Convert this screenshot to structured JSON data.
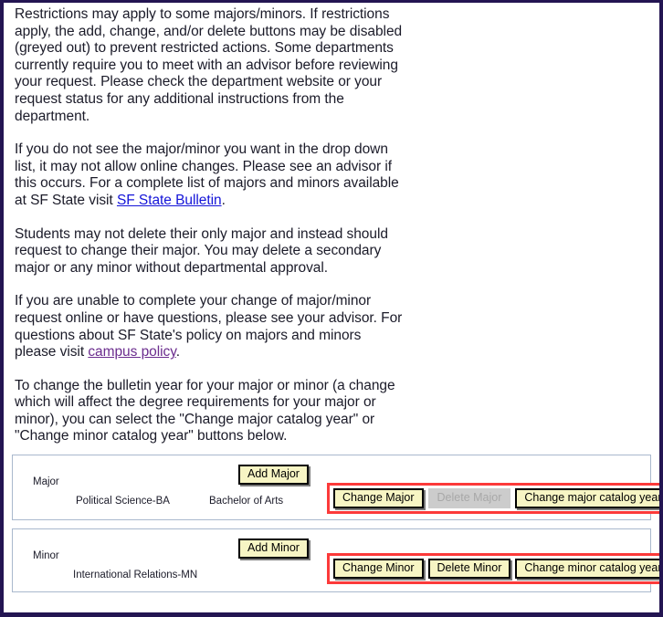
{
  "info": {
    "paragraphs": [
      {
        "id": "p1",
        "text": "Restrictions may apply to some majors/minors. If restrictions apply, the add, change, and/or delete buttons may be disabled (greyed out) to prevent restricted actions. Some departments currently require you to meet with an advisor before reviewing your request. Please check the department website or your request status for any additional instructions from the department."
      },
      {
        "id": "p2",
        "before": "If you do not see the major/minor you want in the drop down list, it may not allow online changes. Please see an advisor if this occurs. For a complete list of majors and minors available at SF State visit ",
        "link": "SF State Bulletin",
        "after": "."
      },
      {
        "id": "p3",
        "text": "Students may not delete their only major and instead should request to change their major. You may delete a secondary major or any minor without departmental approval."
      },
      {
        "id": "p4",
        "before": "If you are unable to complete your change of major/minor request online or have questions, please see your advisor. For questions about SF State's policy on majors and minors please visit ",
        "link": "campus policy",
        "after": "."
      },
      {
        "id": "p5",
        "text": "To change the bulletin year for your major or minor (a change which will affect the degree requirements for your major or minor), you can select the \"Change major catalog year\" or \"Change minor catalog year\" buttons below."
      }
    ]
  },
  "major": {
    "section_label": "Major",
    "add_label": "Add Major",
    "program_name": "Political Science-BA",
    "degree": "Bachelor of Arts",
    "change_label": "Change Major",
    "delete_label": "Delete Major",
    "delete_disabled": true,
    "catalog_year_label": "Change major catalog year"
  },
  "minor": {
    "section_label": "Minor",
    "add_label": "Add Minor",
    "program_name": "International Relations-MN",
    "degree": "",
    "change_label": "Change Minor",
    "delete_label": "Delete Minor",
    "delete_disabled": false,
    "catalog_year_label": "Change minor catalog year"
  },
  "colors": {
    "page_border": "#231552",
    "panel_border": "#a9b8cd",
    "button_face": "#f7f5c4",
    "button_disabled_face": "#cccccc",
    "highlight": "#fc3a3a",
    "link": "#1414d8",
    "link_visited": "#6b2d8e",
    "text": "#1b1b29"
  }
}
